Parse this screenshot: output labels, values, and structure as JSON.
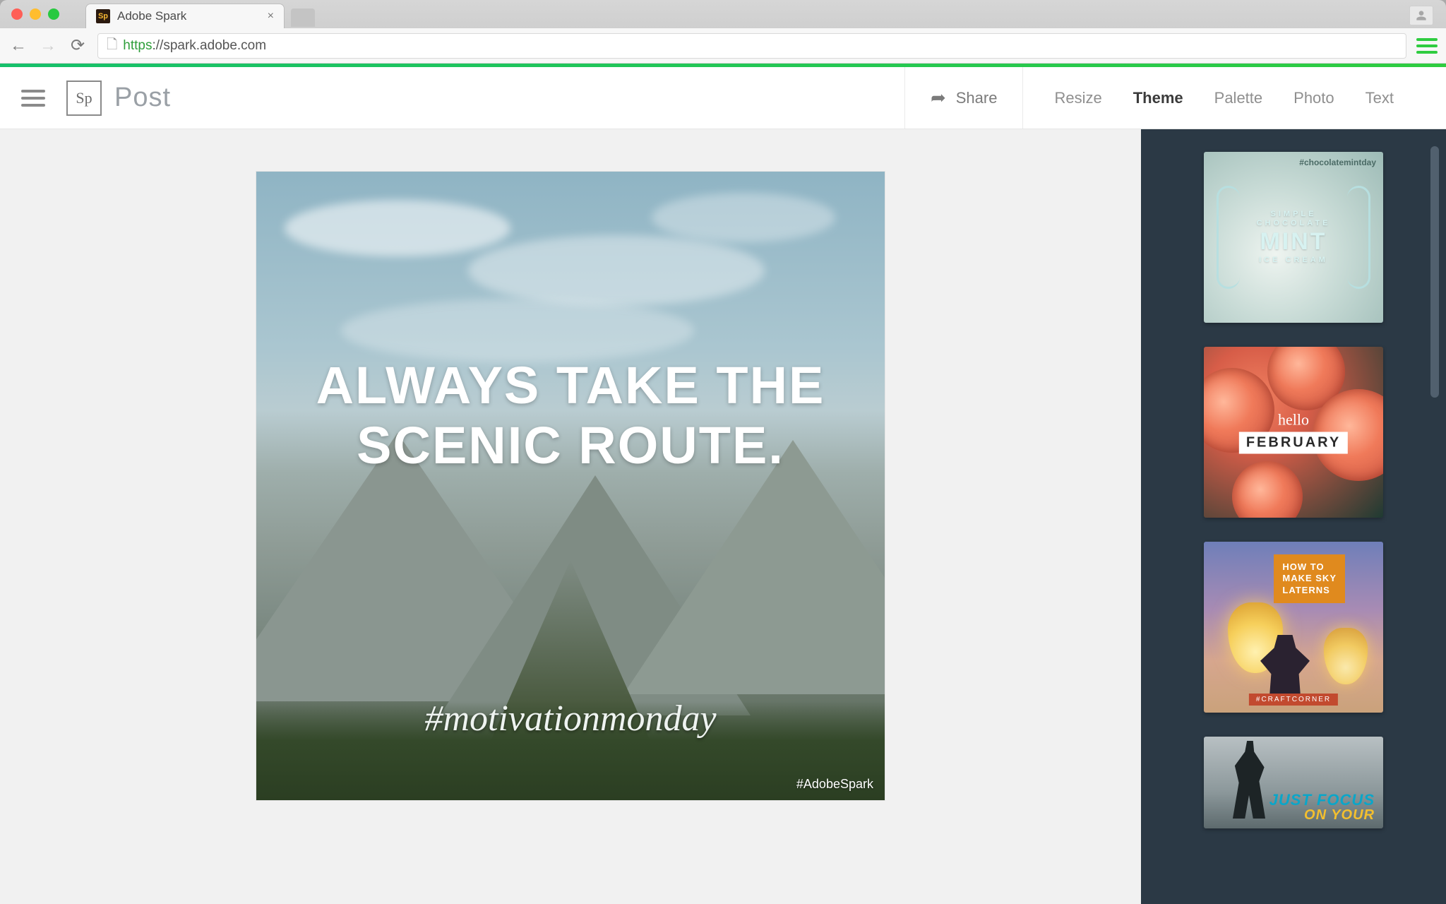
{
  "browser": {
    "tab_title": "Adobe Spark",
    "favicon_text": "Sp",
    "url_scheme": "https",
    "url_rest": "://spark.adobe.com"
  },
  "header": {
    "logo_text": "Sp",
    "app_section": "Post",
    "share_label": "Share",
    "tabs": {
      "resize": "Resize",
      "theme": "Theme",
      "palette": "Palette",
      "photo": "Photo",
      "text": "Text"
    },
    "active_tab": "theme"
  },
  "canvas": {
    "headline_line1": "ALWAYS TAKE THE",
    "headline_line2": "SCENIC ROUTE.",
    "hashtag": "#motivationmonday",
    "watermark": "#AdobeSpark"
  },
  "themes": {
    "mint": {
      "tag": "#chocolatemintday",
      "line_small1": "SIMPLE",
      "line_small2": "CHOCOLATE",
      "line_big": "MINT",
      "line_small3": "ICE CREAM"
    },
    "february": {
      "hello": "hello",
      "month": "FEBRUARY"
    },
    "lanterns": {
      "line1": "HOW TO",
      "line2": "MAKE SKY",
      "line3": "LATERNS",
      "badge": "#CRAFTCORNER"
    },
    "focus": {
      "line1": "JUST FOCUS",
      "line2": "ON YOUR"
    }
  }
}
